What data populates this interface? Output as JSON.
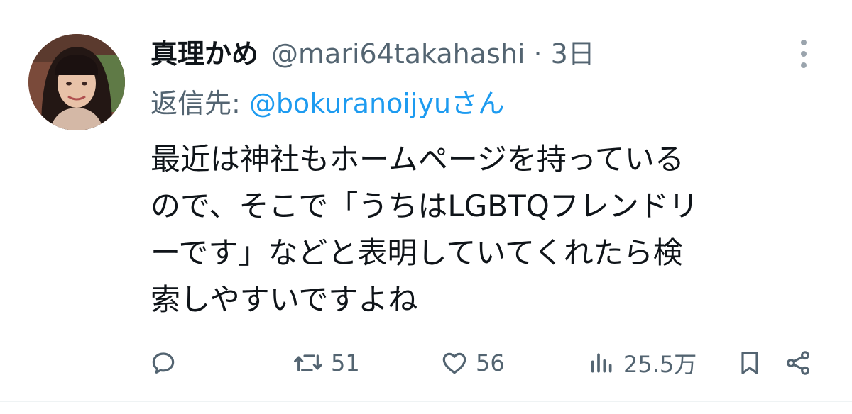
{
  "tweet": {
    "display_name": "真理かめ",
    "handle": "@mari64takahashi",
    "separator": "·",
    "time": "3日",
    "reply_label": "返信先:",
    "reply_user": "@bokuranoijyuさん",
    "body_lines": [
      "最近は神社もホームページを持っている",
      "ので、そこで「うちはLGBTQフレンドリ",
      "ーです」などと表明していてくれたら検",
      "索しやすいですよね"
    ]
  },
  "actions": {
    "reply": {
      "icon": "reply-icon",
      "count": ""
    },
    "retweet": {
      "icon": "retweet-icon",
      "count": "51"
    },
    "like": {
      "icon": "heart-icon",
      "count": "56"
    },
    "views": {
      "icon": "views-icon",
      "count": "25.5万"
    },
    "bookmark": {
      "icon": "bookmark-icon"
    },
    "share": {
      "icon": "share-icon"
    }
  },
  "colors": {
    "text": "#0f1419",
    "secondary": "#536471",
    "link": "#1d9bf0"
  }
}
